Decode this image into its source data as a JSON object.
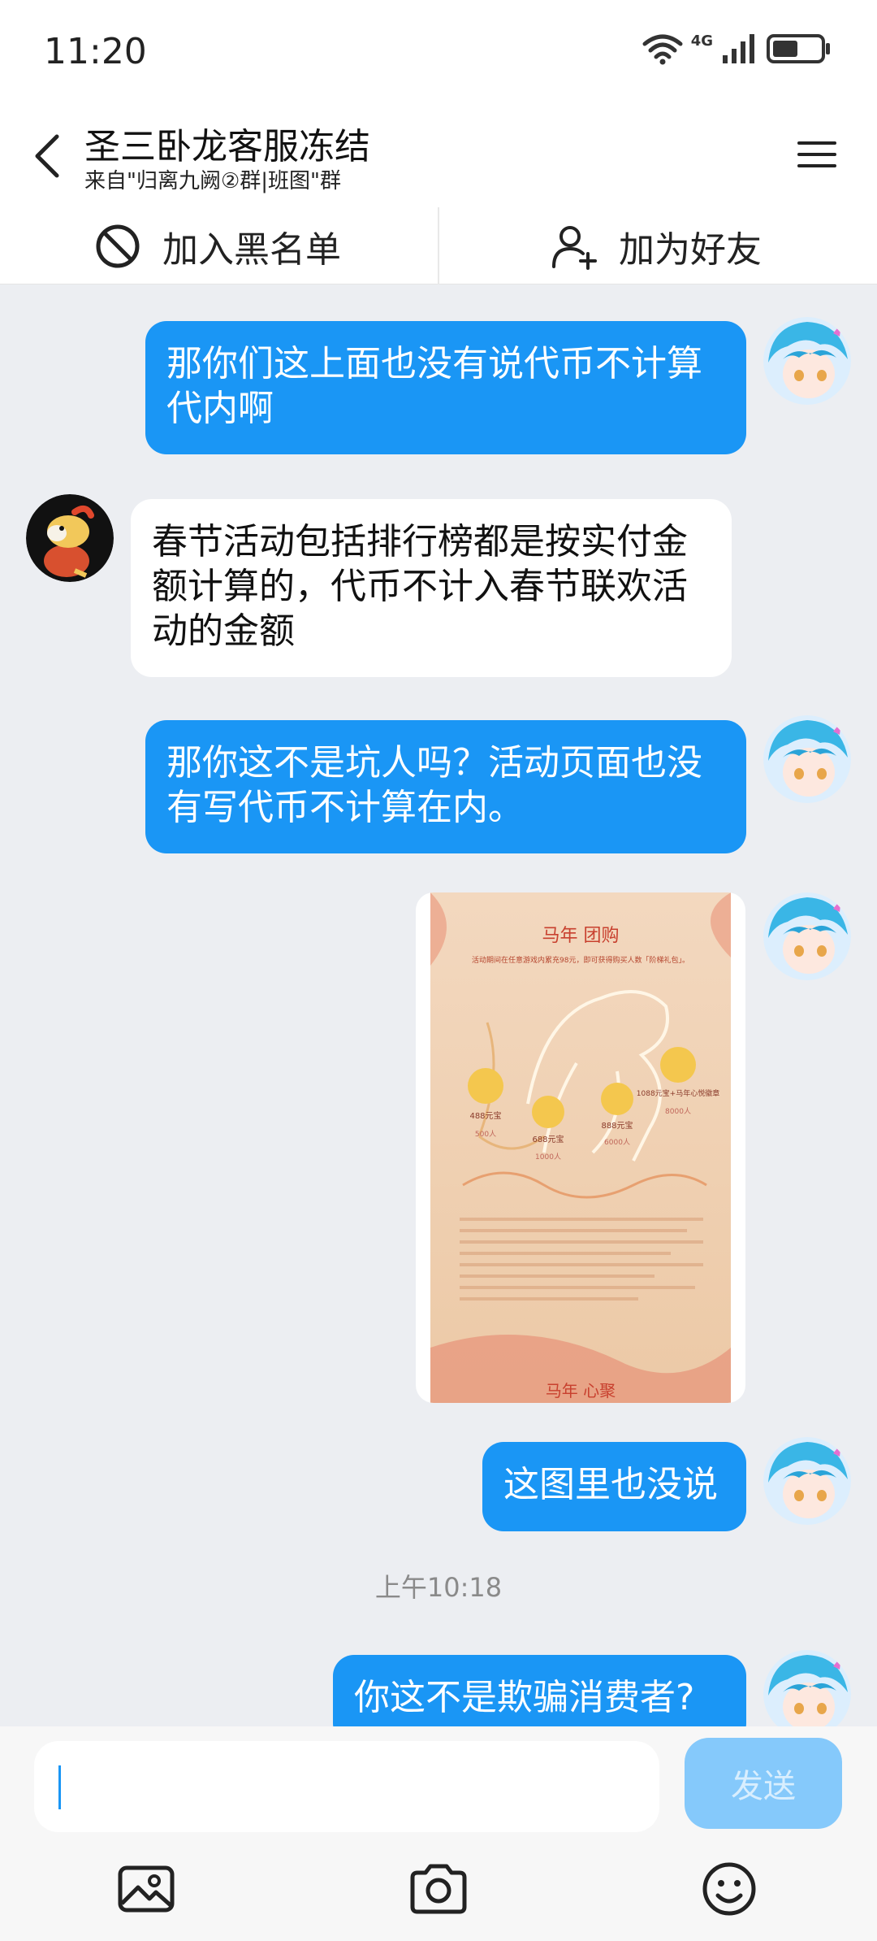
{
  "status_bar": {
    "time": "11:20",
    "network": "4G"
  },
  "header": {
    "title": "圣三卧龙客服冻结",
    "subtitle": "来自\"归离九阙②群|班图\"群"
  },
  "actions": {
    "block_label": "加入黑名单",
    "add_friend_label": "加为好友"
  },
  "messages": [
    {
      "side": "out",
      "text": "那你们这上面也没有说代币不计算代内啊"
    },
    {
      "side": "in",
      "text": "春节活动包括排行榜都是按实付金额计算的，代币不计入春节联欢活动的金额"
    },
    {
      "side": "out",
      "text": "那你这不是坑人吗？活动页面也没有写代币不计算在内。"
    },
    {
      "side": "out",
      "type": "image",
      "image": {
        "title": "马年 团购",
        "desc": "活动期间在任意游戏内累充98元，即可获得购买人数「阶梯礼包」。",
        "tiers": [
          {
            "reward": "488元宝",
            "people": "500人"
          },
          {
            "reward": "688元宝",
            "people": "1000人"
          },
          {
            "reward": "888元宝",
            "people": "6000人"
          },
          {
            "reward": "1088元宝+马年心悦徽章",
            "people": "8000人"
          }
        ],
        "footer": "马年 心聚"
      }
    },
    {
      "side": "out",
      "text": "这图里也没说"
    },
    {
      "side": "out",
      "text": "你这不是欺骗消费者?"
    }
  ],
  "timestamp": "上午10:18",
  "composer": {
    "placeholder": "",
    "send_label": "发送"
  },
  "colors": {
    "accent": "#1a96f5",
    "send_disabled": "#85c9fb",
    "background": "#eceef2"
  },
  "icons": [
    "back-arrow-icon",
    "menu-icon",
    "block-icon",
    "add-friend-icon",
    "image-icon",
    "camera-icon",
    "emoji-icon",
    "wifi-icon",
    "signal-icon",
    "battery-icon"
  ]
}
